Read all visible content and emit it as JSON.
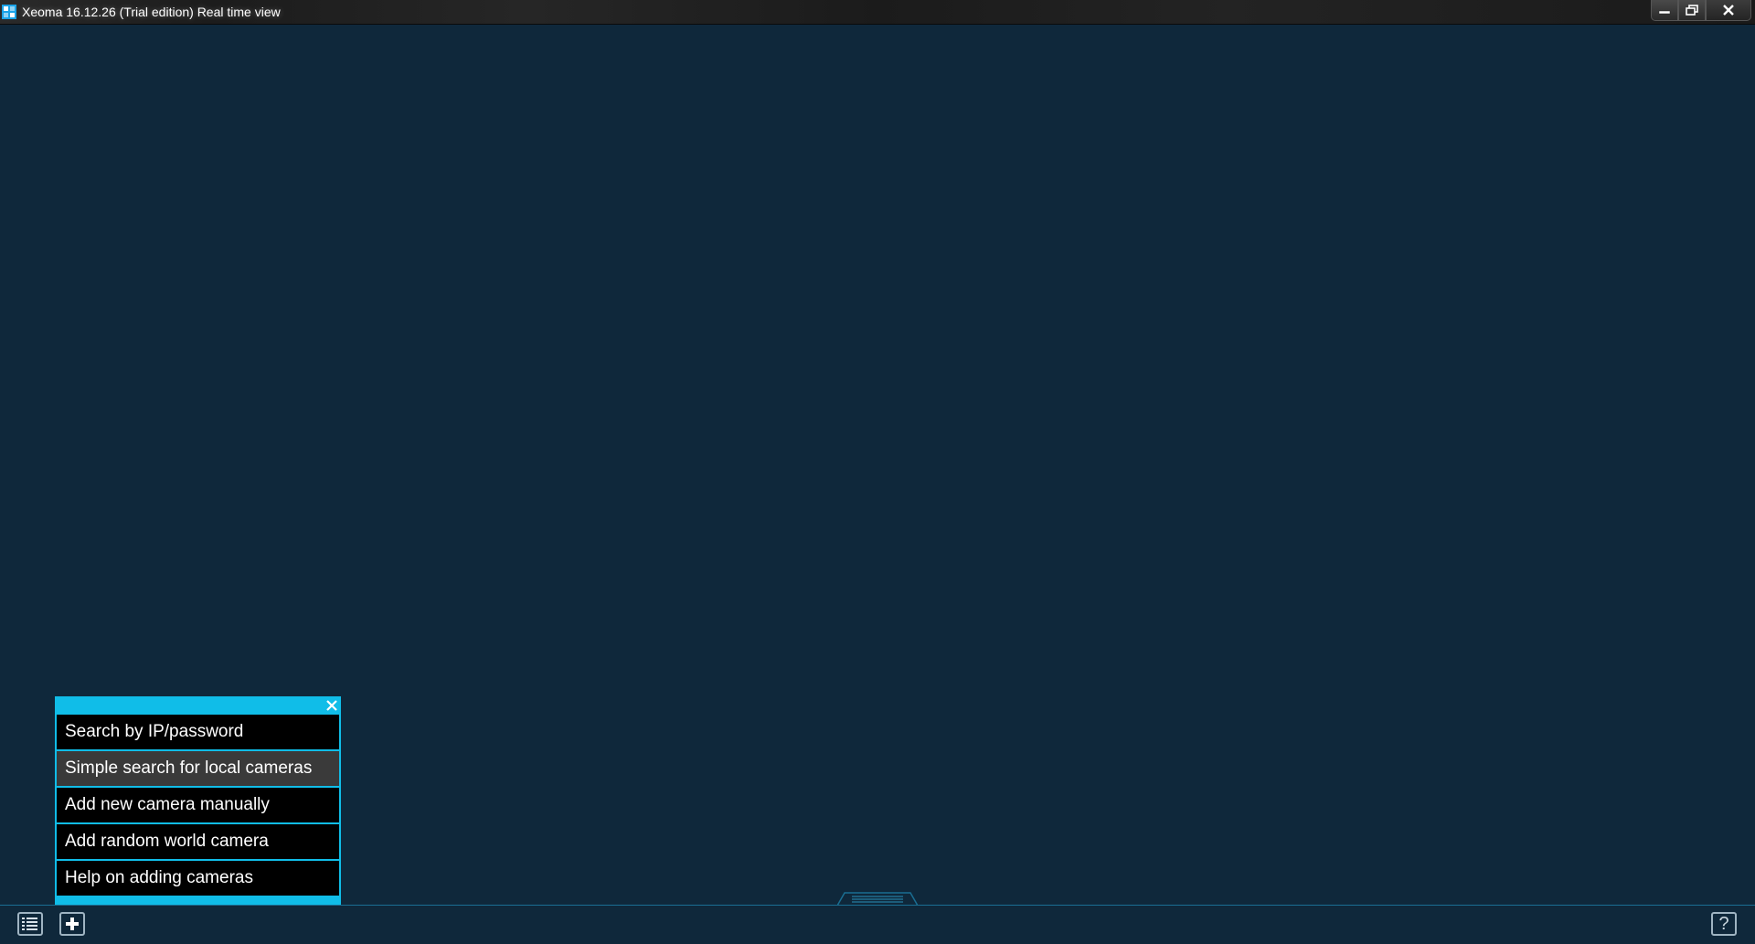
{
  "window": {
    "title": "Xeoma 16.12.26 (Trial edition) Real time view",
    "controls": [
      "minimize-icon",
      "maximize-icon",
      "close-icon"
    ]
  },
  "colors": {
    "background": "#0f283b",
    "accent": "#10bde8",
    "menu_bg": "#000000",
    "menu_hover_bg": "#3a3a3a"
  },
  "add_camera_menu": {
    "items": [
      {
        "label": "Search by IP/password"
      },
      {
        "label": "Simple search for local cameras",
        "highlighted": true
      },
      {
        "label": "Add new camera manually"
      },
      {
        "label": "Add random world camera"
      },
      {
        "label": "Help on adding cameras"
      }
    ],
    "close_icon": "close-icon"
  },
  "bottom_bar": {
    "left_buttons": [
      "list-icon",
      "plus-icon"
    ],
    "right_buttons": [
      "help-icon"
    ],
    "help_label": "?"
  }
}
